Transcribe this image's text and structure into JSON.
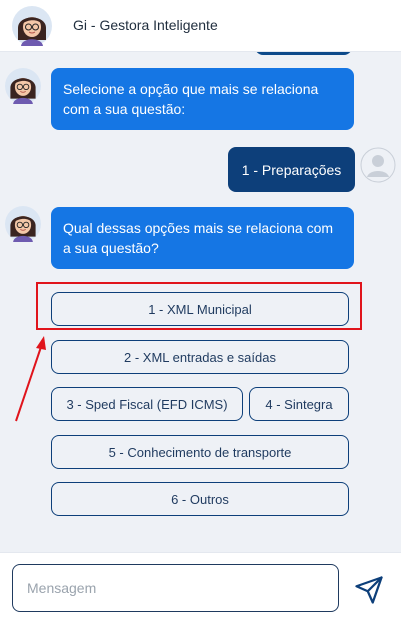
{
  "header": {
    "title": "Gi - Gestora Inteligente",
    "avatar_icon": "assistant-avatar"
  },
  "messages": [
    {
      "from": "bot",
      "text": "Selecione a opção que mais se relaciona com a sua questão:"
    },
    {
      "from": "user",
      "text": "1 - Preparações"
    },
    {
      "from": "bot",
      "text": "Qual dessas opções mais se relaciona com a sua questão?"
    }
  ],
  "options": [
    {
      "label": "1 - XML Municipal"
    },
    {
      "label": "2 - XML entradas e saídas"
    },
    {
      "label": "3 - Sped Fiscal (EFD ICMS)"
    },
    {
      "label": "4 - Sintegra"
    },
    {
      "label": "5 - Conhecimento de transporte"
    },
    {
      "label": "6 - Outros"
    }
  ],
  "composer": {
    "placeholder": "Mensagem",
    "value": "",
    "send_icon": "send-icon"
  },
  "colors": {
    "bot_bubble": "#1576e4",
    "user_bubble": "#0d3f7a",
    "highlight": "#e0141c"
  }
}
